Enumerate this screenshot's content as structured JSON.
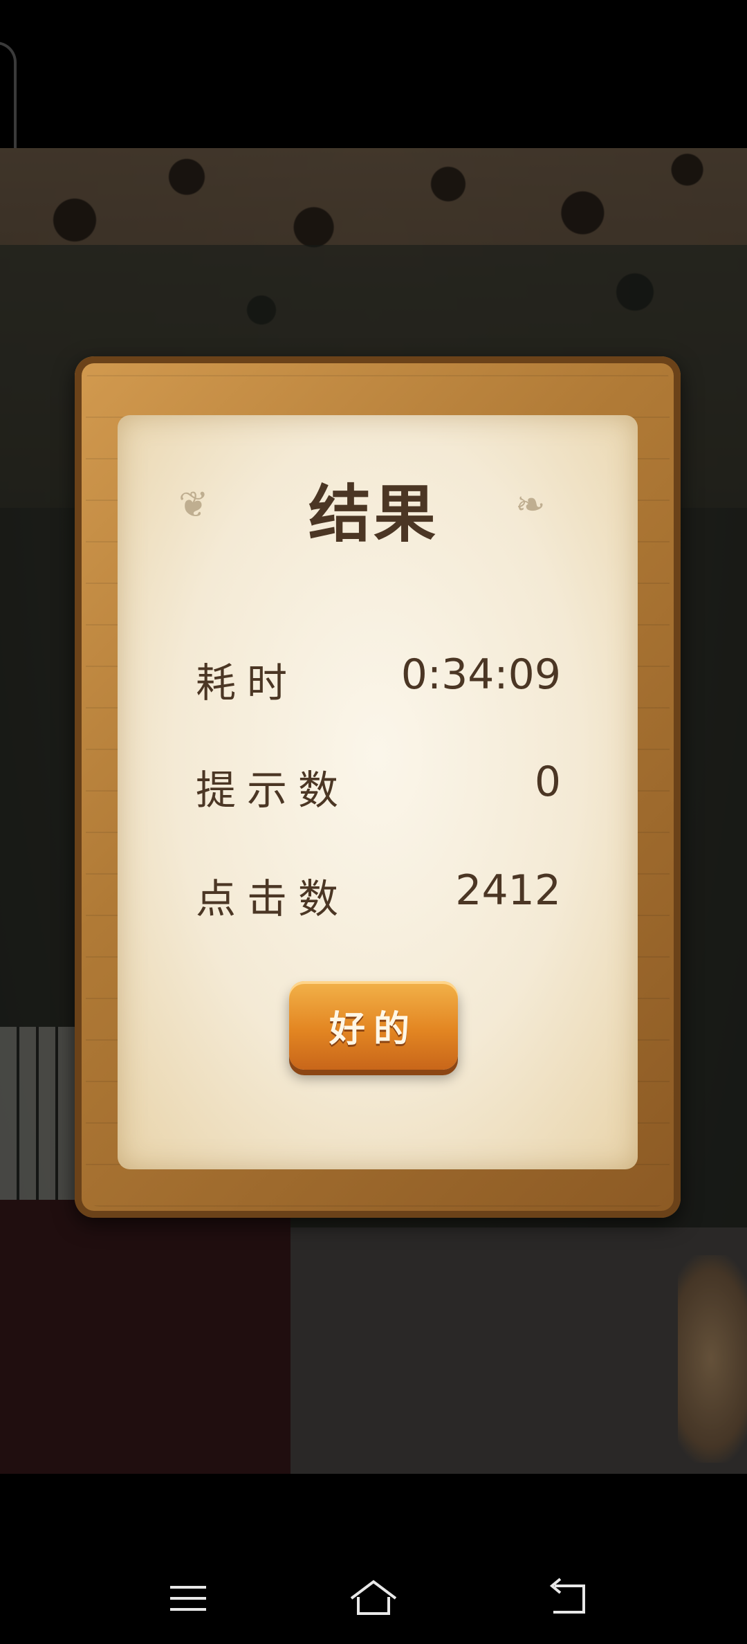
{
  "dialog": {
    "title": "结果",
    "rows": [
      {
        "label": "耗时",
        "value": "0:34:09"
      },
      {
        "label": "提示数",
        "value": "0"
      },
      {
        "label": "点击数",
        "value": "2412"
      }
    ],
    "ok_label": "好的"
  },
  "colors": {
    "text_brown": "#4b3624",
    "button_orange": "#e38622",
    "wood": "#b07a36",
    "parchment": "#f4ead5"
  },
  "nav": {
    "menu_icon": "menu-icon",
    "home_icon": "home-icon",
    "back_icon": "back-icon"
  }
}
